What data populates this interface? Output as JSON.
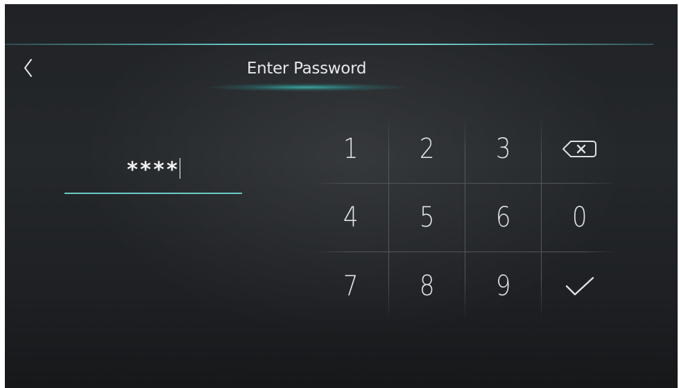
{
  "header": {
    "title": "Enter Password",
    "back_icon": "chevron-left-icon"
  },
  "password": {
    "masked_value": "****"
  },
  "keypad": {
    "keys": [
      {
        "label": "1",
        "type": "digit"
      },
      {
        "label": "2",
        "type": "digit"
      },
      {
        "label": "3",
        "type": "digit"
      },
      {
        "label": "",
        "type": "backspace",
        "icon": "backspace-icon"
      },
      {
        "label": "4",
        "type": "digit"
      },
      {
        "label": "5",
        "type": "digit"
      },
      {
        "label": "6",
        "type": "digit"
      },
      {
        "label": "0",
        "type": "digit"
      },
      {
        "label": "7",
        "type": "digit"
      },
      {
        "label": "8",
        "type": "digit"
      },
      {
        "label": "9",
        "type": "digit"
      },
      {
        "label": "",
        "type": "confirm",
        "icon": "checkmark-icon"
      }
    ]
  },
  "colors": {
    "accent": "#63c3c5",
    "background": "#222427",
    "text": "#e6e8ea"
  }
}
